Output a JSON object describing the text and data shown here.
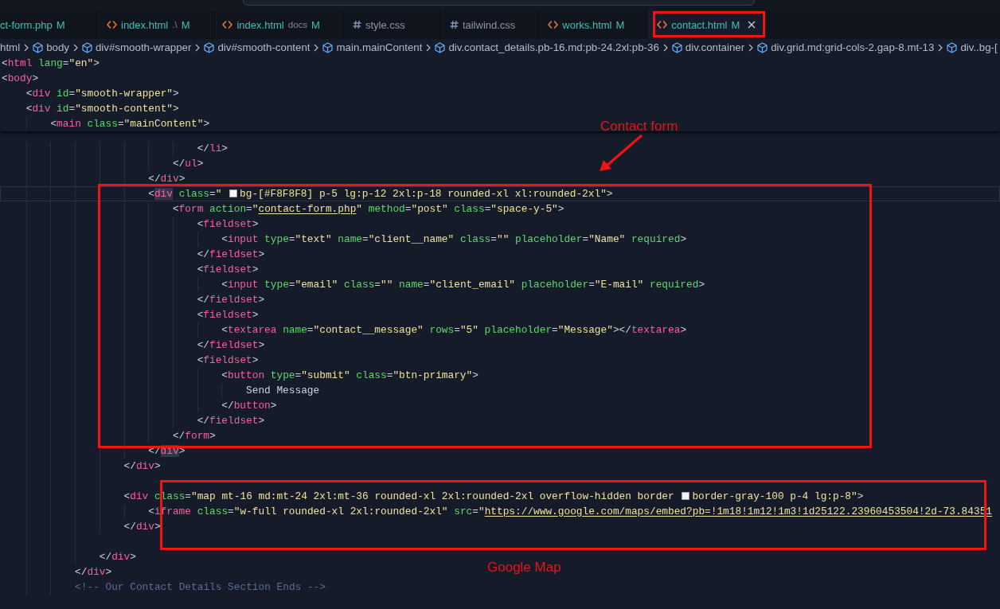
{
  "tabs": [
    {
      "label": "ct-form.php",
      "kind": "php",
      "status": "M",
      "modified": true,
      "selected": false
    },
    {
      "label": "index.html",
      "kind": "html",
      "description": ".\\",
      "status": "M",
      "modified": true,
      "selected": false
    },
    {
      "label": "index.html",
      "kind": "html",
      "description": "docs",
      "status": "M",
      "modified": true,
      "selected": false
    },
    {
      "label": "style.css",
      "kind": "css",
      "modified": false,
      "selected": false
    },
    {
      "label": "tailwind.css",
      "kind": "css",
      "modified": false,
      "selected": false
    },
    {
      "label": "works.html",
      "kind": "html",
      "status": "M",
      "modified": true,
      "selected": false
    },
    {
      "label": "contact.html",
      "kind": "html",
      "status": "M",
      "modified": true,
      "selected": true
    }
  ],
  "breadcrumbs": [
    {
      "label": "html",
      "kind": "plain"
    },
    {
      "label": "body",
      "kind": "element"
    },
    {
      "label": "div#smooth-wrapper",
      "kind": "element"
    },
    {
      "label": "div#smooth-content",
      "kind": "element"
    },
    {
      "label": "main.mainContent",
      "kind": "element"
    },
    {
      "label": "div.contact_details.pb-16.md:pb-24.2xl:pb-36",
      "kind": "element"
    },
    {
      "label": "div.container",
      "kind": "element"
    },
    {
      "label": "div.grid.md:grid-cols-2.gap-8.mt-13",
      "kind": "element"
    },
    {
      "label": "div..bg-[",
      "kind": "element"
    }
  ],
  "sticky_lines": [
    {
      "tokens": [
        {
          "plain": "<"
        },
        {
          "tag": "html"
        },
        {
          "attr": " lang"
        },
        {
          "plain": "="
        },
        {
          "value": "\"en\""
        },
        {
          "plain": ">"
        }
      ]
    },
    {
      "tokens": [
        {
          "plain": "<"
        },
        {
          "tag": "body"
        },
        {
          "plain": ">"
        }
      ]
    },
    {
      "tokens": [
        {
          "plain": "    <"
        },
        {
          "tag": "div"
        },
        {
          "attr": " id"
        },
        {
          "plain": "="
        },
        {
          "value": "\"smooth-wrapper\""
        },
        {
          "plain": ">"
        }
      ]
    },
    {
      "tokens": [
        {
          "plain": "    <"
        },
        {
          "tag": "div"
        },
        {
          "attr": " id"
        },
        {
          "plain": "="
        },
        {
          "value": "\"smooth-content\""
        },
        {
          "plain": ">"
        }
      ]
    },
    {
      "tokens": [
        {
          "plain": "        <"
        },
        {
          "tag": "main"
        },
        {
          "attr": " class"
        },
        {
          "plain": "="
        },
        {
          "value": "\"mainContent\""
        },
        {
          "plain": ">"
        }
      ]
    }
  ],
  "lines": [
    {
      "kind": "code",
      "current": false,
      "tokens": [
        {
          "plain": "                                </"
        },
        {
          "tag": "li"
        },
        {
          "plain": ">"
        }
      ]
    },
    {
      "kind": "code",
      "current": false,
      "tokens": [
        {
          "plain": "                            </"
        },
        {
          "tag": "ul"
        },
        {
          "plain": ">"
        }
      ]
    },
    {
      "kind": "code",
      "current": false,
      "tokens": [
        {
          "plain": "                        </"
        },
        {
          "tag": "div"
        },
        {
          "plain": ">"
        }
      ]
    },
    {
      "kind": "code",
      "current": true,
      "tokens": [
        {
          "plain": "                        <"
        },
        {
          "matched_tag": "div"
        },
        {
          "attr": " class"
        },
        {
          "plain": "="
        },
        {
          "value": "\" "
        },
        {
          "color": "#f8f8f8"
        },
        {
          "value": "bg-[#F8F8F8] p-5 lg:p-12 2xl:p-18 rounded-xl xl:rounded-2xl\""
        },
        {
          "plain": ">"
        }
      ]
    },
    {
      "kind": "code",
      "current": false,
      "tokens": [
        {
          "plain": "                            <"
        },
        {
          "tag": "form"
        },
        {
          "attr": " action"
        },
        {
          "plain": "="
        },
        {
          "value": "\""
        },
        {
          "link": "contact-form.php"
        },
        {
          "value": "\""
        },
        {
          "attr": " method"
        },
        {
          "plain": "="
        },
        {
          "value": "\"post\""
        },
        {
          "attr": " class"
        },
        {
          "plain": "="
        },
        {
          "value": "\"space-y-5\""
        },
        {
          "plain": ">"
        }
      ]
    },
    {
      "kind": "code",
      "current": false,
      "tokens": [
        {
          "plain": "                                <"
        },
        {
          "tag": "fieldset"
        },
        {
          "plain": ">"
        }
      ]
    },
    {
      "kind": "code",
      "current": false,
      "tokens": [
        {
          "plain": "                                    <"
        },
        {
          "tag": "input"
        },
        {
          "attr": " type"
        },
        {
          "plain": "="
        },
        {
          "value": "\"text\""
        },
        {
          "attr": " name"
        },
        {
          "plain": "="
        },
        {
          "value": "\"client__name\""
        },
        {
          "attr": " class"
        },
        {
          "plain": "="
        },
        {
          "value": "\"\""
        },
        {
          "attr": " placeholder"
        },
        {
          "plain": "="
        },
        {
          "value": "\"Name\""
        },
        {
          "attr": " required"
        },
        {
          "plain": ">"
        }
      ]
    },
    {
      "kind": "code",
      "current": false,
      "tokens": [
        {
          "plain": "                                </"
        },
        {
          "tag": "fieldset"
        },
        {
          "plain": ">"
        }
      ]
    },
    {
      "kind": "code",
      "current": false,
      "tokens": [
        {
          "plain": "                                <"
        },
        {
          "tag": "fieldset"
        },
        {
          "plain": ">"
        }
      ]
    },
    {
      "kind": "code",
      "current": false,
      "tokens": [
        {
          "plain": "                                    <"
        },
        {
          "tag": "input"
        },
        {
          "attr": " type"
        },
        {
          "plain": "="
        },
        {
          "value": "\"email\""
        },
        {
          "attr": " class"
        },
        {
          "plain": "="
        },
        {
          "value": "\"\""
        },
        {
          "attr": " name"
        },
        {
          "plain": "="
        },
        {
          "value": "\"client_email\""
        },
        {
          "attr": " placeholder"
        },
        {
          "plain": "="
        },
        {
          "value": "\"E-mail\""
        },
        {
          "attr": " required"
        },
        {
          "plain": ">"
        }
      ]
    },
    {
      "kind": "code",
      "current": false,
      "tokens": [
        {
          "plain": "                                </"
        },
        {
          "tag": "fieldset"
        },
        {
          "plain": ">"
        }
      ]
    },
    {
      "kind": "code",
      "current": false,
      "tokens": [
        {
          "plain": "                                <"
        },
        {
          "tag": "fieldset"
        },
        {
          "plain": ">"
        }
      ]
    },
    {
      "kind": "code",
      "current": false,
      "tokens": [
        {
          "plain": "                                    <"
        },
        {
          "tag": "textarea"
        },
        {
          "attr": " name"
        },
        {
          "plain": "="
        },
        {
          "value": "\"contact__message\""
        },
        {
          "attr": " rows"
        },
        {
          "plain": "="
        },
        {
          "value": "\"5\""
        },
        {
          "attr": " placeholder"
        },
        {
          "plain": "="
        },
        {
          "value": "\"Message\""
        },
        {
          "plain": "></"
        },
        {
          "tag": "textarea"
        },
        {
          "plain": ">"
        }
      ]
    },
    {
      "kind": "code",
      "current": false,
      "tokens": [
        {
          "plain": "                                </"
        },
        {
          "tag": "fieldset"
        },
        {
          "plain": ">"
        }
      ]
    },
    {
      "kind": "code",
      "current": false,
      "tokens": [
        {
          "plain": "                                <"
        },
        {
          "tag": "fieldset"
        },
        {
          "plain": ">"
        }
      ]
    },
    {
      "kind": "code",
      "current": false,
      "tokens": [
        {
          "plain": "                                    <"
        },
        {
          "tag": "button"
        },
        {
          "attr": " type"
        },
        {
          "plain": "="
        },
        {
          "value": "\"submit\""
        },
        {
          "attr": " class"
        },
        {
          "plain": "="
        },
        {
          "value": "\"btn-primary\""
        },
        {
          "plain": ">"
        }
      ]
    },
    {
      "kind": "code",
      "current": false,
      "tokens": [
        {
          "plain": "                                        Send Message"
        }
      ]
    },
    {
      "kind": "code",
      "current": false,
      "tokens": [
        {
          "plain": "                                    </"
        },
        {
          "tag": "button"
        },
        {
          "plain": ">"
        }
      ]
    },
    {
      "kind": "code",
      "current": false,
      "tokens": [
        {
          "plain": "                                </"
        },
        {
          "tag": "fieldset"
        },
        {
          "plain": ">"
        }
      ]
    },
    {
      "kind": "code",
      "current": false,
      "tokens": [
        {
          "plain": "                            </"
        },
        {
          "tag": "form"
        },
        {
          "plain": ">"
        }
      ]
    },
    {
      "kind": "code",
      "current": false,
      "tokens": [
        {
          "plain": "                        </"
        },
        {
          "matched_tag": "div"
        },
        {
          "plain": ">"
        }
      ]
    },
    {
      "kind": "code",
      "current": false,
      "tokens": [
        {
          "plain": "                    </"
        },
        {
          "tag": "div"
        },
        {
          "plain": ">"
        }
      ]
    },
    {
      "kind": "blank",
      "current": false
    },
    {
      "kind": "code",
      "current": false,
      "tokens": [
        {
          "plain": "                    <"
        },
        {
          "tag": "div"
        },
        {
          "attr": " class"
        },
        {
          "plain": "="
        },
        {
          "value": "\"map mt-16 md:mt-24 2xl:mt-36 rounded-xl 2xl:rounded-2xl overflow-hidden border "
        },
        {
          "color": "#f3f4f6"
        },
        {
          "value": "border-gray-100 p-4 lg:p-8\""
        },
        {
          "plain": ">"
        }
      ]
    },
    {
      "kind": "code",
      "current": false,
      "tokens": [
        {
          "plain": "                        <"
        },
        {
          "tag": "iframe"
        },
        {
          "attr": " class"
        },
        {
          "plain": "="
        },
        {
          "value": "\"w-full rounded-xl 2xl:rounded-2xl\""
        },
        {
          "attr": " src"
        },
        {
          "plain": "="
        },
        {
          "value": "\""
        },
        {
          "link": "https://www.google.com/maps/embed?pb=!1m18!1m12!1m3!1d25122.23960453504!2d-73.84351"
        }
      ]
    },
    {
      "kind": "code",
      "current": false,
      "tokens": [
        {
          "plain": "                    </"
        },
        {
          "tag": "div"
        },
        {
          "plain": ">"
        }
      ]
    },
    {
      "kind": "blank",
      "current": false
    },
    {
      "kind": "code",
      "current": false,
      "tokens": [
        {
          "plain": "                </"
        },
        {
          "tag": "div"
        },
        {
          "plain": ">"
        }
      ]
    },
    {
      "kind": "code",
      "current": false,
      "tokens": [
        {
          "plain": "            </"
        },
        {
          "tag": "div"
        },
        {
          "plain": ">"
        }
      ]
    },
    {
      "kind": "code",
      "current": false,
      "tokens": [
        {
          "comment": "            <!-- Our Contact Details Section Ends -->"
        }
      ]
    }
  ],
  "annotations": [
    "Contact form",
    "Google Map"
  ]
}
